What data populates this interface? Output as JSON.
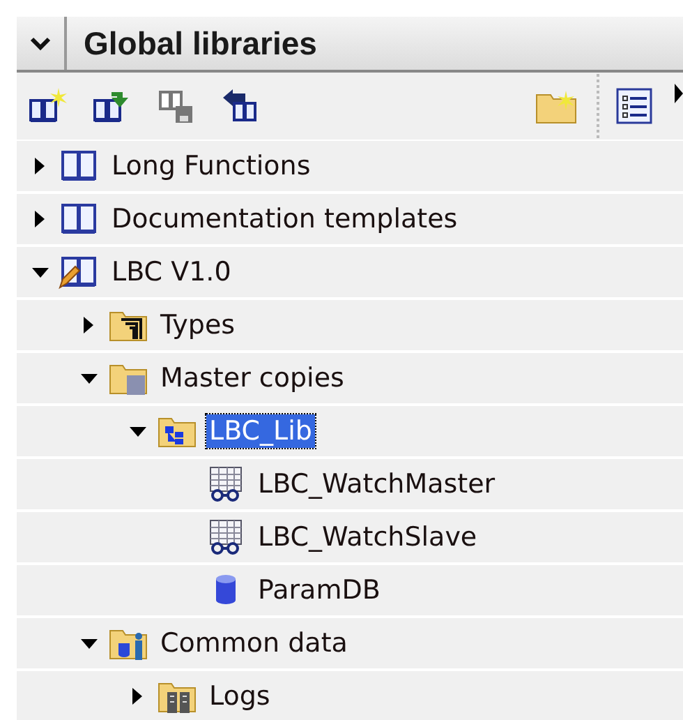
{
  "panel": {
    "title": "Global libraries",
    "expanded": true
  },
  "tree": [
    {
      "label": "Long Functions",
      "kind": "library",
      "expanded": false,
      "selected": false
    },
    {
      "label": "Documentation templates",
      "kind": "library",
      "expanded": false,
      "selected": false
    },
    {
      "label": "LBC V1.0",
      "kind": "library-edit",
      "expanded": true,
      "selected": false,
      "children": [
        {
          "label": "Types",
          "kind": "types-folder",
          "expanded": false,
          "selected": false
        },
        {
          "label": "Master copies",
          "kind": "master-folder",
          "expanded": true,
          "selected": false,
          "children": [
            {
              "label": "LBC_Lib",
              "kind": "group-folder",
              "expanded": true,
              "selected": true,
              "children": [
                {
                  "label": "LBC_WatchMaster",
                  "kind": "watch-table",
                  "selected": false
                },
                {
                  "label": "LBC_WatchSlave",
                  "kind": "watch-table",
                  "selected": false
                },
                {
                  "label": "ParamDB",
                  "kind": "data-block",
                  "selected": false
                }
              ]
            }
          ]
        },
        {
          "label": "Common data",
          "kind": "common-folder",
          "expanded": true,
          "selected": false,
          "children": [
            {
              "label": "Logs",
              "kind": "logs-folder",
              "expanded": false,
              "selected": false
            }
          ]
        }
      ]
    }
  ]
}
